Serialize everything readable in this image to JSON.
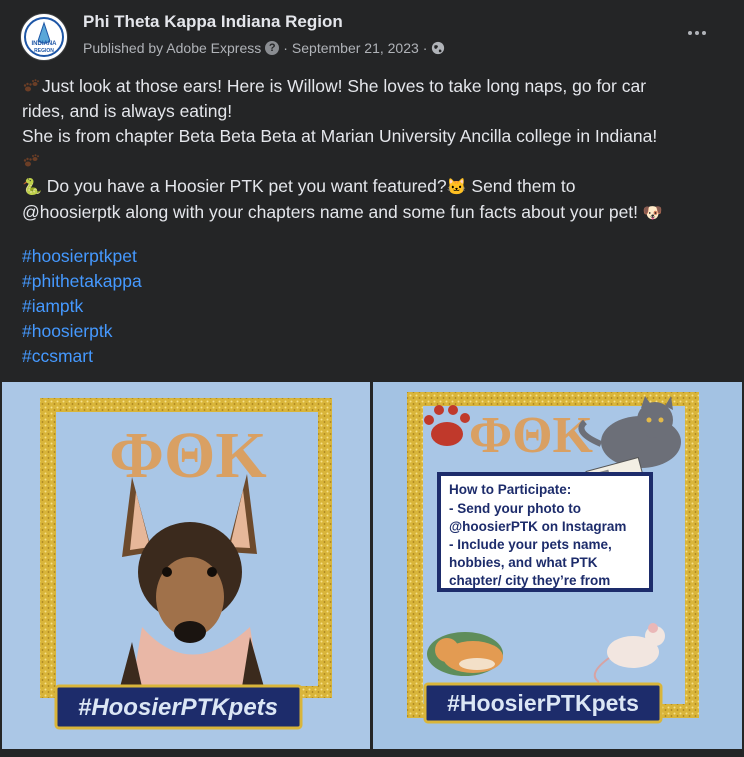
{
  "post": {
    "author": "Phi Theta Kappa Indiana Region",
    "published_by": "Published by Adobe Express",
    "help_icon": "?",
    "separator": "·",
    "date": "September 21, 2023",
    "privacy_icon": "globe-icon",
    "more_icon": "more-options-icon"
  },
  "avatar": {
    "top_text": "PHI THETA KAPPA HONOR SOCIETY",
    "line1": "INDIANA",
    "line2": "REGION"
  },
  "body": {
    "line1": "Just look at those ears! Here is Willow! She loves to take long naps, go for car",
    "line2": "rides, and is always eating!",
    "line3": "She is from chapter Beta Beta Beta at Marian University Ancilla college in Indiana!",
    "line5a": " Do you have a Hoosier PTK pet you want featured?",
    "line5b": " Send them to",
    "line6": "@hoosierptk along with your chapters name and some fun facts about your pet! "
  },
  "emojis": {
    "paw": "paw-prints-icon",
    "snake": "🐍",
    "cat": "🐱",
    "dog": "🐶"
  },
  "hashtags": [
    "#hoosierptkpet",
    "#phithetakappa",
    "#iamptk",
    "#hoosierptk",
    "#ccsmart"
  ],
  "images": {
    "left": {
      "greek": "ΦΘΚ",
      "banner": "#HoosierPTKpets"
    },
    "right": {
      "greek": "ΦΘΚ",
      "heading": "How to Participate:",
      "line1": "- Send your photo to",
      "line2": "@hoosierPTK on Instagram",
      "line3": "- Include your pets name,",
      "line4": "hobbies, and what PTK",
      "line5": "chapter/ city they’re from",
      "banner": "#HoosierPTKpets"
    }
  },
  "colors": {
    "card_bg": "#242526",
    "text": "#e4e6eb",
    "muted": "#b0b3b8",
    "link": "#4599ff",
    "photo_bg": "#a3c2e3",
    "gold": "#d9b53a",
    "banner_navy": "#1d2c6b",
    "greek_tan": "#d9a063"
  }
}
